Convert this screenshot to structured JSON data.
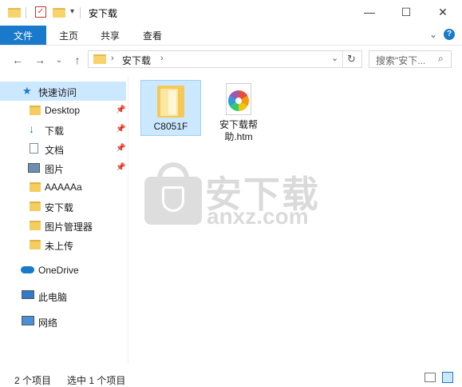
{
  "title": "安下载",
  "window_controls": {
    "minimize": "—",
    "maximize": "☐",
    "close": "✕"
  },
  "ribbon": {
    "tabs": [
      "文件",
      "主页",
      "共享",
      "查看"
    ],
    "collapse_icon": "chevron-down-icon",
    "help_icon": "help-icon"
  },
  "address": {
    "path_segments": [
      "安下载"
    ],
    "search_placeholder": "搜索\"安下..."
  },
  "sidebar": {
    "items": [
      {
        "label": "快速访问",
        "icon": "star-icon",
        "pinned": false
      },
      {
        "label": "Desktop",
        "icon": "folder-icon",
        "pinned": true
      },
      {
        "label": "下载",
        "icon": "download-icon",
        "pinned": true
      },
      {
        "label": "文档",
        "icon": "document-icon",
        "pinned": true
      },
      {
        "label": "图片",
        "icon": "picture-icon",
        "pinned": true
      },
      {
        "label": "AAAAAa",
        "icon": "folder-icon",
        "pinned": false
      },
      {
        "label": "安下载",
        "icon": "folder-icon",
        "pinned": false
      },
      {
        "label": "图片管理器",
        "icon": "folder-icon",
        "pinned": false
      },
      {
        "label": "未上传",
        "icon": "folder-icon",
        "pinned": false
      },
      {
        "label": "OneDrive",
        "icon": "cloud-icon",
        "pinned": false
      },
      {
        "label": "此电脑",
        "icon": "computer-icon",
        "pinned": false
      },
      {
        "label": "网络",
        "icon": "network-icon",
        "pinned": false
      }
    ]
  },
  "files": [
    {
      "name": "C8051F",
      "type": "folder",
      "selected": true
    },
    {
      "name_line1": "安下载帮",
      "name_line2": "助.htm",
      "type": "htm",
      "selected": false
    }
  ],
  "watermark": {
    "main": "安下载",
    "sub": "anxz.com"
  },
  "status": {
    "count": "2 个项目",
    "selected": "选中 1 个项目"
  },
  "colors": {
    "accent": "#1979ca",
    "selection": "#cce8ff"
  }
}
